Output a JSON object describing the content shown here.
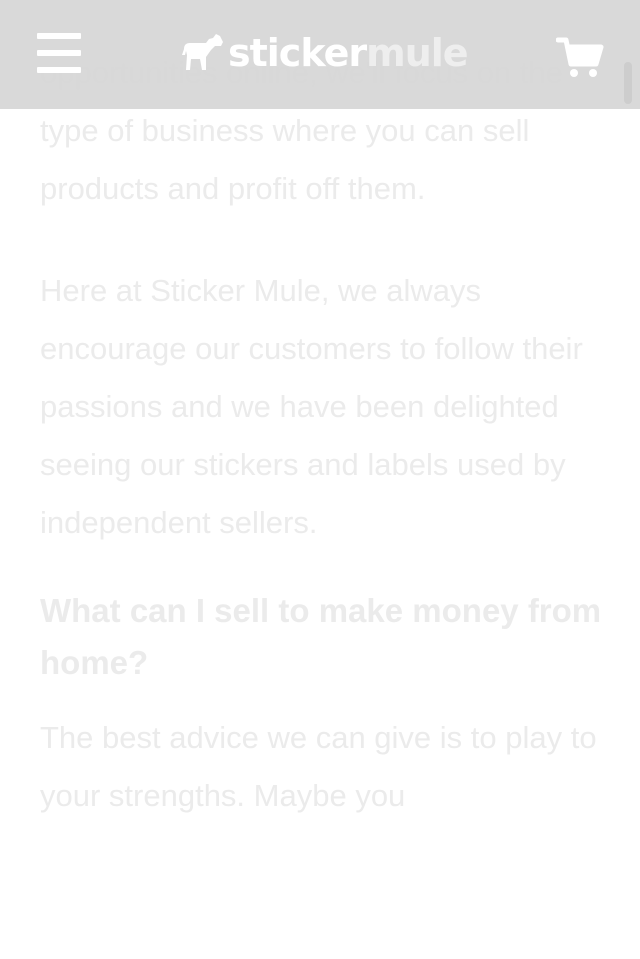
{
  "header": {
    "logo_part1": "sticker",
    "logo_part2": "mule",
    "colors": {
      "bar": "#d6d6d6",
      "icons": "#ffffff",
      "logo_secondary": "#eeeeee"
    },
    "icons": {
      "menu": "hamburger-icon",
      "cart": "cart-icon"
    }
  },
  "article": {
    "paragraphs": [
      "opportunities online, we'll focus on the type of business where you can sell products and profit off them.",
      "Here at Sticker Mule, we always encourage our customers to follow their passions and we have been delighted seeing our stickers and labels used by independent sellers."
    ],
    "heading": "What can I sell to make money from home?",
    "paragraph_after": "The best advice we can give is to play to your strengths. Maybe you",
    "text_color": "#ebebeb"
  }
}
